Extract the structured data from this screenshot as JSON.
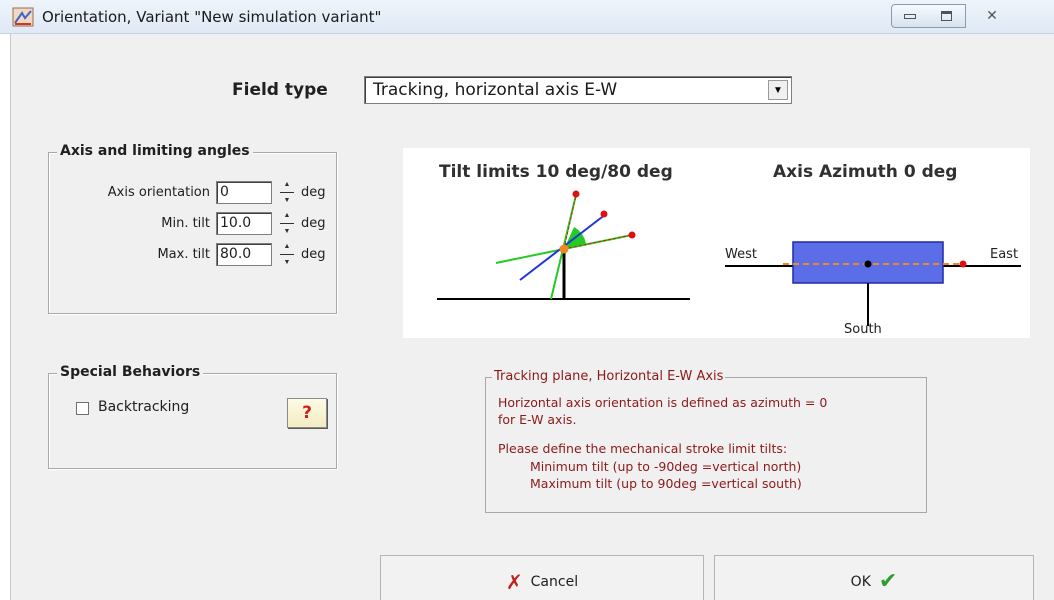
{
  "window": {
    "title": "Orientation, Variant \"New simulation variant\"",
    "close_glyph": "✕"
  },
  "field_type": {
    "label": "Field type",
    "selected": "Tracking, horizontal axis E-W",
    "arrow": "▼"
  },
  "axis_group": {
    "title": "Axis and limiting angles",
    "rows": [
      {
        "label": "Axis orientation",
        "value": "0",
        "unit": "deg"
      },
      {
        "label": "Min. tilt",
        "value": "10.0",
        "unit": "deg"
      },
      {
        "label": "Max. tilt",
        "value": "80.0",
        "unit": "deg"
      }
    ]
  },
  "special_group": {
    "title": "Special Behaviors",
    "backtracking_label": "Backtracking",
    "backtracking_checked": false,
    "help_label": "?"
  },
  "diagrams": {
    "tilt_title": "Tilt limits 10 deg/80 deg",
    "azimuth_title": "Axis Azimuth 0 deg",
    "west": "West",
    "east": "East",
    "south": "South"
  },
  "info": {
    "title": "Tracking plane, Horizontal E-W Axis",
    "line1": "Horizontal axis orientation is defined as azimuth = 0",
    "line2": "for E-W axis.",
    "line3": "Please define the mechanical stroke limit tilts:",
    "line4": "Minimum tilt  (up to -90deg =vertical north)",
    "line5": "Maximum tilt  (up to 90deg =vertical south)"
  },
  "buttons": {
    "cancel_label": "Cancel",
    "cancel_icon": "✗",
    "ok_label": "OK",
    "ok_icon": "✔"
  },
  "colors": {
    "info_text": "#8b1a1a",
    "panel_fill": "#5b6ee8",
    "tilt_green": "#22cc22",
    "axis_blue": "#2233dd",
    "marker_red": "#dd1111",
    "pivot_orange": "#f08a1c"
  }
}
